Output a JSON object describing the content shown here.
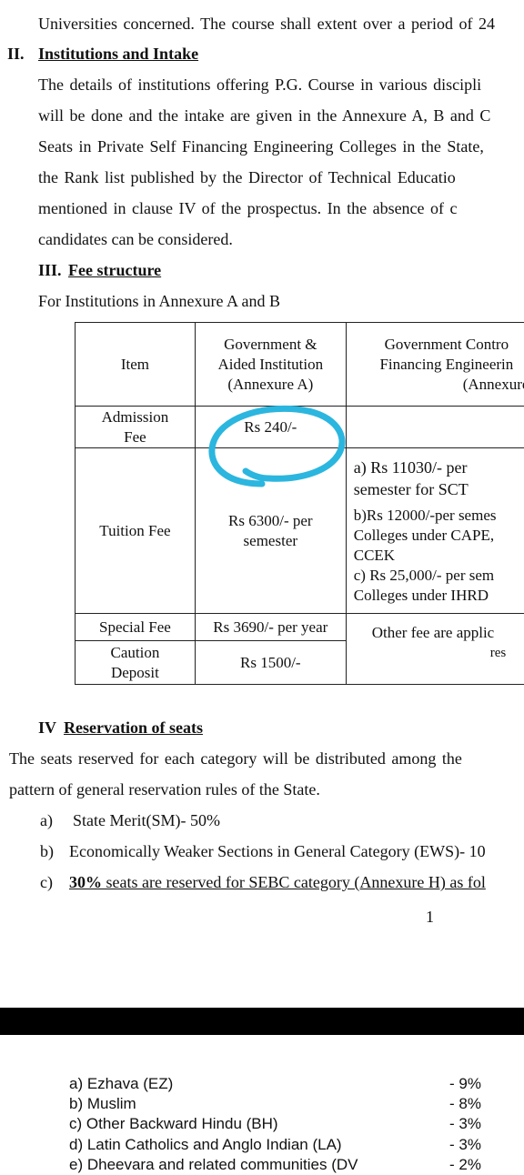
{
  "intro": {
    "line": "Universities concerned.  The course shall extent over a period of 24"
  },
  "section2": {
    "num": "II.",
    "title": "Institutions and Intake",
    "lines": [
      "The details of institutions offering P.G. Course in various discipli",
      "will be done and the intake are given in the Annexure A, B and C",
      "Seats in Private Self Financing Engineering Colleges in the State,",
      "the Rank list published by the Director of Technical Educatio",
      "mentioned in clause IV of the prospectus. In the absence of c",
      "candidates can be considered."
    ]
  },
  "section3": {
    "num": "III.",
    "title": "Fee structure",
    "subtitle": "For Institutions in Annexure A and B"
  },
  "fee_table": {
    "header": {
      "item": "Item",
      "col2": [
        "Government &",
        "Aided Institution",
        "(Annexure A)"
      ],
      "col3": [
        "Government Contro",
        "Financing Engineerin",
        "(Annexure B"
      ]
    },
    "rows": {
      "admission": {
        "label": [
          "Admission",
          "Fee"
        ],
        "value": "Rs 240/-"
      },
      "tuition": {
        "label": "Tuition Fee",
        "value": [
          "Rs 6300/- per",
          "semester"
        ],
        "col3": [
          "a) Rs 11030/- per",
          "semester for SCT",
          "b)Rs 12000/-per semes",
          "Colleges under CAPE,",
          "CCEK",
          "c) Rs 25,000/- per sem",
          "Colleges under IHRD"
        ]
      },
      "special": {
        "label": "Special Fee",
        "value": "Rs 3690/- per year"
      },
      "caution": {
        "label": [
          "Caution",
          "Deposit"
        ],
        "value": "Rs 1500/-"
      },
      "other": [
        "Other fee are applic",
        "res"
      ]
    }
  },
  "section4": {
    "num": "IV",
    "title": "Reservation of seats",
    "lines": [
      "The seats reserved for each category  will be distributed among the",
      "pattern of general reservation rules of the State."
    ],
    "items": [
      {
        "marker": "a)",
        "text": "State Merit(SM)- 50%"
      },
      {
        "marker": "b)",
        "text": "Economically Weaker Sections in General Category (EWS)- 10"
      },
      {
        "marker": "c)",
        "text_bold": "30%",
        "text": " seats are reserved for SEBC category (Annexure H) as fol"
      }
    ]
  },
  "page_number": "1",
  "next_page": {
    "items": [
      {
        "label": "a) Ezhava (EZ)",
        "pct": "- 9%"
      },
      {
        "label": "b) Muslim",
        "pct": "- 8%"
      },
      {
        "label": "c) Other Backward Hindu (BH)",
        "pct": "- 3%"
      },
      {
        "label": "d) Latin Catholics and Anglo Indian (LA)",
        "pct": "- 3%"
      },
      {
        "label": "e) Dheevara and related communities (DV",
        "pct": "- 2%"
      }
    ]
  },
  "colors": {
    "annotation": "#2bb6df",
    "bar": "#000000"
  }
}
